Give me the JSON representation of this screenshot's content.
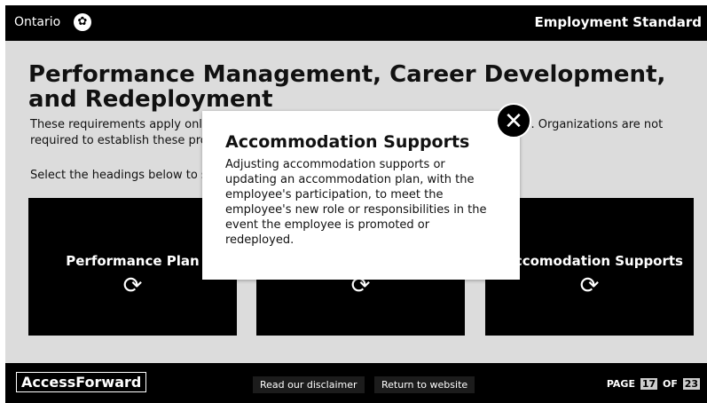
{
  "header": {
    "logo_text": "Ontario",
    "title": "Employment Standard"
  },
  "main": {
    "heading": "Performance Management, Career Development, and Redeployment",
    "intro": "These requirements apply only to obligated organizations in the Ontario Public Service. Organizations are not required to establish these processes.",
    "instruction": "Select the headings below to see the requirements that apply:",
    "cards": [
      {
        "label": "Performance Plan",
        "icon": "refresh-icon"
      },
      {
        "label": "",
        "icon": "refresh-icon"
      },
      {
        "label": "Accomodation Supports",
        "icon": "refresh-icon"
      }
    ]
  },
  "modal": {
    "title": "Accommodation Supports",
    "body": "Adjusting accommodation supports or updating an accommodation plan, with the employee's participation, to meet the employee's new role or responsibilities in the event the employee is promoted or redeployed.",
    "close_icon": "close-icon"
  },
  "footer": {
    "brand": "AccessForward",
    "disclaimer_label": "Read our disclaimer",
    "return_label": "Return to website",
    "page_prefix": "PAGE",
    "page_current": "17",
    "page_of": "OF",
    "page_total": "23"
  }
}
